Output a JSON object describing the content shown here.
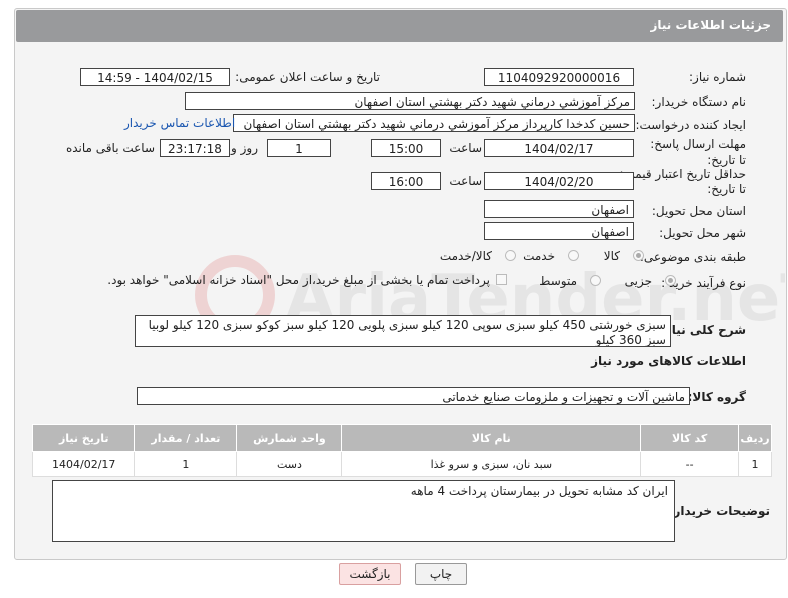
{
  "header": {
    "title": "جزئیات اطلاعات نیاز"
  },
  "fields": {
    "need_number_label": "شماره نیاز:",
    "need_number": "1104092920000016",
    "announce_label": "تاریخ و ساعت اعلان عمومی:",
    "announce_value": "1404/02/15 - 14:59",
    "buyer_org_label": "نام دستگاه خریدار:",
    "buyer_org": "مرکز آموزشي درماني شهيد دکتر بهشتي استان اصفهان",
    "creator_label": "ایجاد کننده درخواست:",
    "creator": "حسين کدخدا کارپرداز مرکز آموزشي درماني شهيد دکتر بهشتي استان اصفهان",
    "contact_link": "اطلاعات تماس خریدار",
    "deadline_label": "مهلت ارسال پاسخ: تا تاریخ:",
    "deadline_date": "1404/02/17",
    "hour_label": "ساعت",
    "deadline_time": "15:00",
    "day_count": "1",
    "day_and_label": "روز و",
    "remaining_time": "23:17:18",
    "remaining_label": "ساعت باقی مانده",
    "min_price_label": "حداقل تاریخ اعتبار قیمت:",
    "min_price_to_label": "تا تاریخ:",
    "price_date": "1404/02/20",
    "price_time": "16:00",
    "province_label": "استان محل تحویل:",
    "province": "اصفهان",
    "city_label": "شهر محل تحویل:",
    "city": "اصفهان",
    "category_label": "طبقه بندی موضوعی:",
    "category_options": [
      "کالا",
      "خدمت",
      "کالا/خدمت"
    ],
    "process_label": "نوع فرآیند خرید :",
    "process_options": [
      "جزیی",
      "متوسط"
    ],
    "payment_note": "پرداخت تمام یا بخشی از مبلغ خرید،از محل \"اسناد خزانه اسلامی\" خواهد بود.",
    "description_label": "شرح کلی نیاز:",
    "description": "سبزی خورشتی 450 کیلو سبزی سوپی 120 کیلو سبزی پلویی 120 کیلو سبز کوکو سبزی 120 کیلو لوبیا سبز 360 کیلو"
  },
  "goods": {
    "section_title": "اطلاعات کالاهای مورد نیاز",
    "group_label": "گروه کالا:",
    "group_value": "ماشین آلات و تجهیزات و ملزومات صنایع خدماتی",
    "columns": [
      "ردیف",
      "کد کالا",
      "نام کالا",
      "واحد شمارش",
      "تعداد / مقدار",
      "تاریخ نیاز"
    ],
    "rows": [
      {
        "index": "1",
        "code": "--",
        "name": "سبد نان، سبزی و سرو غذا",
        "unit": "دست",
        "qty": "1",
        "date": "1404/02/17"
      }
    ]
  },
  "notes": {
    "label": "توضیحات خریدار:",
    "text": "ایران کد مشابه تحویل در بیمارستان پرداخت 4 ماهه"
  },
  "buttons": {
    "print": "چاپ",
    "back": "بازگشت"
  },
  "watermark_text": "AriaTender.neT"
}
